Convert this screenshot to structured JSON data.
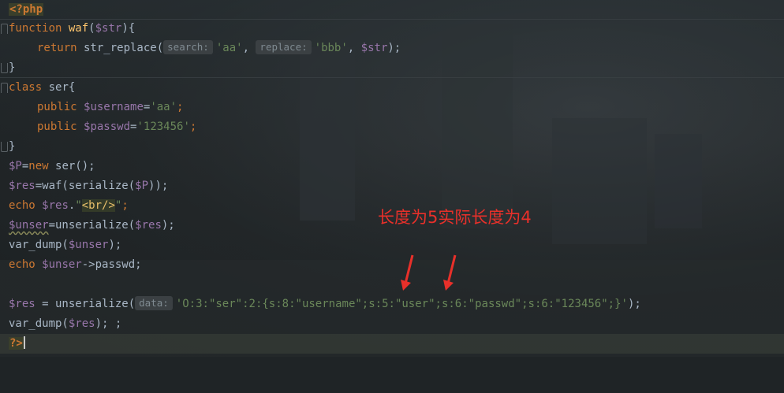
{
  "code_lines": {
    "l1": {
      "tag": "<?php"
    },
    "l2": {
      "kw": "function",
      "name": "waf",
      "open": "(",
      "param": "$str",
      "close": "){"
    },
    "l3": {
      "kw": "return",
      "fn": " str_replace(",
      "hint1": "search:",
      "s1": "'aa'",
      "comma1": ", ",
      "hint2": "replace:",
      "s2": "'bbb'",
      "comma2": ", ",
      "v": "$str",
      "end": ");"
    },
    "l4": {
      "text": "}"
    },
    "l5": {
      "kw": "class",
      "rest": " ser{"
    },
    "l6": {
      "kw": "public",
      "sp": " ",
      "v": "$username",
      "eq": "=",
      "s": "'aa'",
      "end": ";"
    },
    "l7": {
      "kw": "public",
      "sp": " ",
      "v": "$passwd",
      "eq": "=",
      "s": "'123456'",
      "end": ";"
    },
    "l8": {
      "text": "}"
    },
    "l9": {
      "v": "$P",
      "eq": "=",
      "kw": "new",
      "rest": " ser();"
    },
    "l10": {
      "v": "$res",
      "mid": "=waf(serialize(",
      "v2": "$P",
      "end": "));"
    },
    "l11": {
      "kw": "echo",
      "sp": " ",
      "v": "$res",
      "dot": ".",
      "q1": "\"",
      "tag": "<br/>",
      "q2": "\"",
      "end": ";"
    },
    "l12": {
      "v": "$unser",
      "mid": "=unserialize(",
      "v2": "$res",
      "end": ");"
    },
    "l13": {
      "pre": "var_dump(",
      "v": "$unser",
      "end": ");"
    },
    "l14": {
      "kw": "echo",
      "sp": " ",
      "v": "$unser",
      "rest": "->passwd;"
    },
    "l16": {
      "v": "$res",
      "mid": " = unserialize(",
      "hint": "data:",
      "s": "'O:3:\"ser\":2:{s:8:\"username\";s:5:\"user\";s:6:\"passwd\";s:6:\"123456\";}'",
      "end": ");"
    },
    "l17": {
      "pre": "var_dump(",
      "v": "$res",
      "end": "); ;"
    },
    "l18": {
      "tag": "?>"
    }
  },
  "annotation": {
    "text": "长度为5实际长度为4",
    "color": "#e8302a"
  },
  "colors": {
    "keyword": "#cc7832",
    "function": "#ffc66d",
    "variable": "#9876aa",
    "string": "#6a8759",
    "text": "#a9b7c6"
  }
}
